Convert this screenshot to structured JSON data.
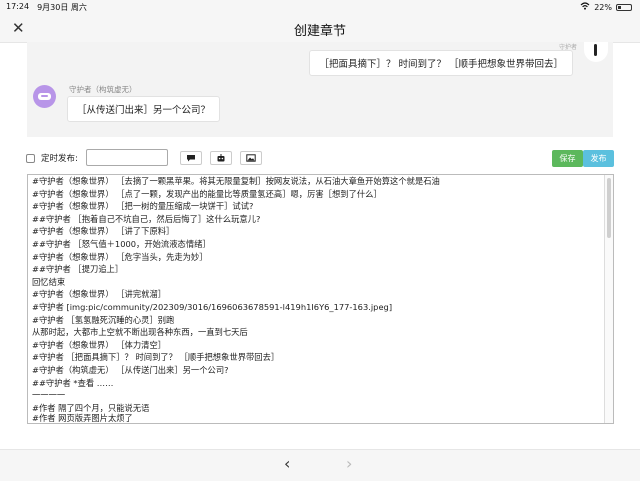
{
  "status_bar": {
    "time": "17:24",
    "date": "9月30日 周六",
    "battery": "22%"
  },
  "nav": {
    "title": "创建章节",
    "close_icon": "close-icon"
  },
  "chat": {
    "right_sender": "守护者",
    "right_message": "［把面具摘下］？ 时间到了？ ［顺手把想象世界带回去］",
    "left_sender": "守护者（构筑虚无）",
    "left_message": "［从传送门出来］另一个公司？"
  },
  "toolbar": {
    "timer_label": "定时发布:",
    "time_value": "",
    "icons": [
      "chat-bubble-icon",
      "robot-icon",
      "image-icon"
    ],
    "save_label": "保存",
    "publish_label": "发布"
  },
  "editor": {
    "lines": [
      "#守护者（想象世界）  ［去摘了一颗黑苹果。将其无限量复制］按网友说法，从石油大章鱼开始算这个就是石油",
      "#守护者（想象世界）  ［点了一颗，发现产出的能量比等质量氢还高］嗯，厉害［想到了什么］",
      "#守护者（想象世界）  ［把一树的量压缩成一块饼干］试试?",
      "##守护者 ［抱着自己不坑自己，然后后悔了］这什么玩意儿?",
      "#守护者（想象世界）  ［讲了下原料］",
      "##守护者 ［怒气值＋1000，开始流液态情绪］",
      "#守护者（想象世界）  ［危字当头，先走为妙］",
      "##守护者 ［提刀追上］",
      "回忆结束",
      "#守护者（想象世界）  ［讲完就溜］",
      "#守护者 [img:pic/community/202309/3016/1696063678591-l419h1I6Y6_177-163.jpeg]",
      "#守护者 ［氢氢融死沉睡的心灵］别跑",
      "从那时起，大都市上空就不断出现各种东西，一直到七天后",
      "#守护者（想象世界）  ［体力清空］",
      "#守护者 ［把面具摘下］？ 时间到了？ ［顺手把想象世界带回去］",
      "#守护者（构筑虚无）  ［从传送门出来］另一个公司?",
      "##守护者 *查看 ……",
      "一一一一",
      "#作者 隔了四个月，只能说无语",
      "#作者 网页版弄图片太烦了"
    ]
  },
  "bottom_bar": {
    "back_icon": "chevron-left-icon",
    "forward_icon": "chevron-right-icon"
  }
}
